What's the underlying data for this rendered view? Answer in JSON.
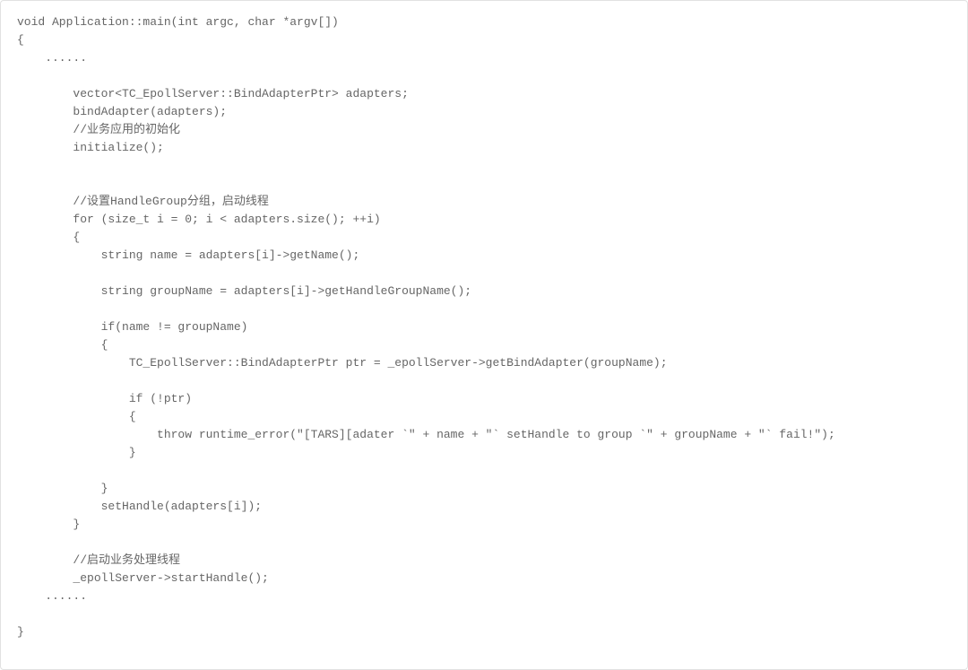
{
  "code": {
    "lines": [
      "void Application::main(int argc, char *argv[])",
      "{",
      "    ......",
      "",
      "        vector<TC_EpollServer::BindAdapterPtr> adapters;",
      "        bindAdapter(adapters);",
      "        //业务应用的初始化",
      "        initialize();",
      "",
      "",
      "        //设置HandleGroup分组，启动线程",
      "        for (size_t i = 0; i < adapters.size(); ++i)",
      "        {",
      "            string name = adapters[i]->getName();",
      "",
      "            string groupName = adapters[i]->getHandleGroupName();",
      "",
      "            if(name != groupName)",
      "            {",
      "                TC_EpollServer::BindAdapterPtr ptr = _epollServer->getBindAdapter(groupName);",
      "",
      "                if (!ptr)",
      "                {",
      "                    throw runtime_error(\"[TARS][adater `\" + name + \"` setHandle to group `\" + groupName + \"` fail!\");",
      "                }",
      "",
      "            }",
      "            setHandle(adapters[i]);",
      "        }",
      "",
      "        //启动业务处理线程",
      "        _epollServer->startHandle();",
      "    ......",
      "",
      "}"
    ]
  }
}
